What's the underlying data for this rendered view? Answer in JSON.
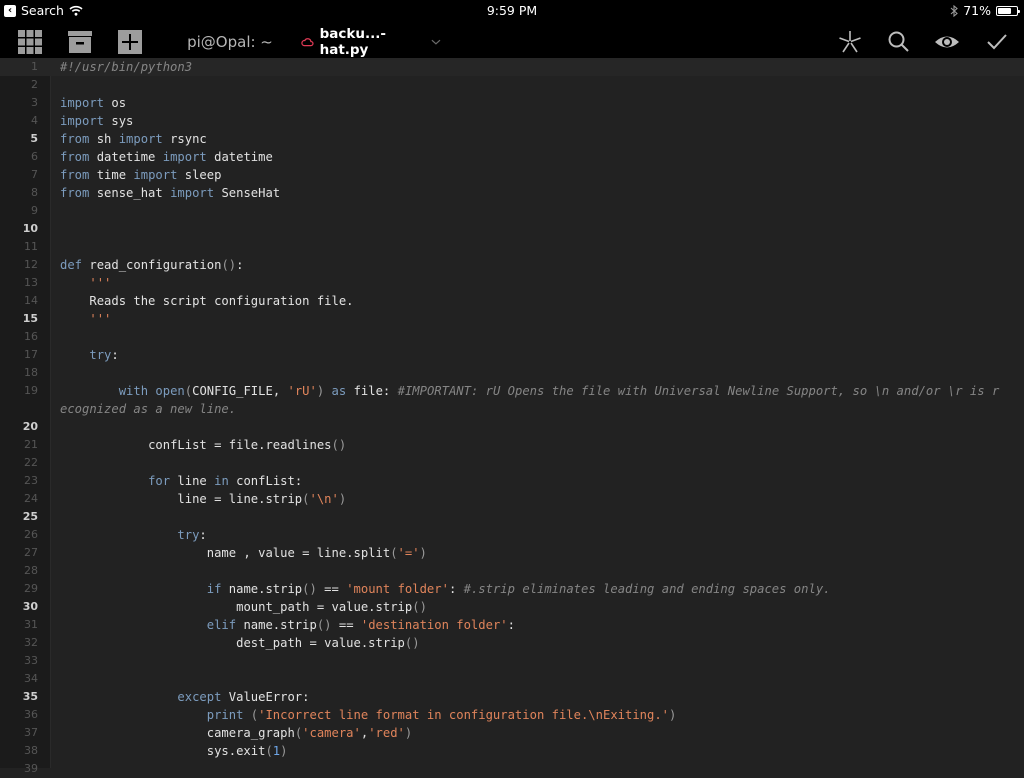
{
  "status_bar": {
    "back_label": "Search",
    "time": "9:59 PM",
    "battery_percent": "71%",
    "battery_level": 0.71,
    "icons": [
      "back-icon",
      "wifi-icon",
      "bluetooth-icon",
      "battery-icon"
    ]
  },
  "toolbar": {
    "left_icons": [
      "grid-icon",
      "archive-icon",
      "add-icon"
    ],
    "right_icons": [
      "snippets-icon",
      "search-icon",
      "preview-icon",
      "done-icon"
    ],
    "tabs": [
      {
        "label": "pi@Opal: ~",
        "accent": "#9a4fe0",
        "active": false
      },
      {
        "label": "backu...-hat.py",
        "accent": "#e03a55",
        "active": true,
        "cloud_icon": "cloud-icon",
        "dropdown_icon": "chevron-down-icon"
      }
    ]
  },
  "editor": {
    "language": "python",
    "colors": {
      "background": "#222222",
      "keyword": "#7c9cbe",
      "string": "#e0845b",
      "comment": "#858585",
      "number": "#6ea6e8",
      "text": "#e2e2e2"
    },
    "lines": [
      {
        "n": "1",
        "text": "#!/usr/bin/python3"
      },
      {
        "n": "2",
        "text": ""
      },
      {
        "n": "3",
        "text": "import os"
      },
      {
        "n": "4",
        "text": "import sys"
      },
      {
        "n": "5",
        "text": "from sh import rsync"
      },
      {
        "n": "6",
        "text": "from datetime import datetime"
      },
      {
        "n": "7",
        "text": "from time import sleep"
      },
      {
        "n": "8",
        "text": "from sense_hat import SenseHat"
      },
      {
        "n": "9",
        "text": ""
      },
      {
        "n": "10",
        "text": ""
      },
      {
        "n": "11",
        "text": ""
      },
      {
        "n": "12",
        "text": "def read_configuration():"
      },
      {
        "n": "13",
        "text": "    '''"
      },
      {
        "n": "14",
        "text": "    Reads the script configuration file."
      },
      {
        "n": "15",
        "text": "    '''"
      },
      {
        "n": "16",
        "text": ""
      },
      {
        "n": "17",
        "text": "    try:"
      },
      {
        "n": "18",
        "text": ""
      },
      {
        "n": "19",
        "text": "        with open(CONFIG_FILE, 'rU') as file: #IMPORTANT: rU Opens the file with Universal Newline Support, so \\n and/or \\r is recognized as a new line."
      },
      {
        "n": "20",
        "text": ""
      },
      {
        "n": "21",
        "text": "            confList = file.readlines()"
      },
      {
        "n": "22",
        "text": ""
      },
      {
        "n": "23",
        "text": "            for line in confList:"
      },
      {
        "n": "24",
        "text": "                line = line.strip('\\n')"
      },
      {
        "n": "25",
        "text": ""
      },
      {
        "n": "26",
        "text": "                try:"
      },
      {
        "n": "27",
        "text": "                    name , value = line.split('=')"
      },
      {
        "n": "28",
        "text": ""
      },
      {
        "n": "29",
        "text": "                    if name.strip() == 'mount folder': #.strip eliminates leading and ending spaces only."
      },
      {
        "n": "30",
        "text": "                        mount_path = value.strip()"
      },
      {
        "n": "31",
        "text": "                    elif name.strip() == 'destination folder':"
      },
      {
        "n": "32",
        "text": "                        dest_path = value.strip()"
      },
      {
        "n": "33",
        "text": ""
      },
      {
        "n": "34",
        "text": ""
      },
      {
        "n": "35",
        "text": "                except ValueError:"
      },
      {
        "n": "36",
        "text": "                    print ('Incorrect line format in configuration file.\\nExiting.')"
      },
      {
        "n": "37",
        "text": "                    camera_graph('camera','red')"
      },
      {
        "n": "38",
        "text": "                    sys.exit(1)"
      },
      {
        "n": "39",
        "text": ""
      }
    ],
    "bold_line_numbers": [
      "5",
      "10",
      "15",
      "20",
      "25",
      "30",
      "35"
    ]
  }
}
